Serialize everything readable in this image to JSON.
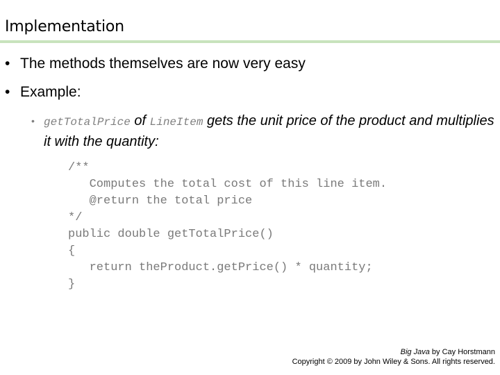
{
  "slide": {
    "title": "Implementation",
    "accent_color": "#c8e3bd",
    "bullets": [
      {
        "marker": "•",
        "text": "The methods themselves are now very easy"
      },
      {
        "marker": "•",
        "text": "Example:"
      }
    ],
    "sub_bullet": {
      "marker": "•",
      "method_name": "getTotalPrice",
      "of_word": " of ",
      "class_name": "LineItem",
      "text_after": " gets the unit price of the product and multiplies it with the quantity:"
    },
    "code_lines": [
      "/**",
      "   Computes the total cost of this line item.",
      "   @return the total price",
      "*/",
      "public double getTotalPrice()",
      "{",
      "   return theProduct.getPrice() * quantity;",
      "}"
    ]
  },
  "footer": {
    "book_title": "Big Java",
    "author_text": " by Cay Horstmann",
    "copyright": "Copyright © 2009 by John Wiley & Sons.  All rights reserved."
  }
}
